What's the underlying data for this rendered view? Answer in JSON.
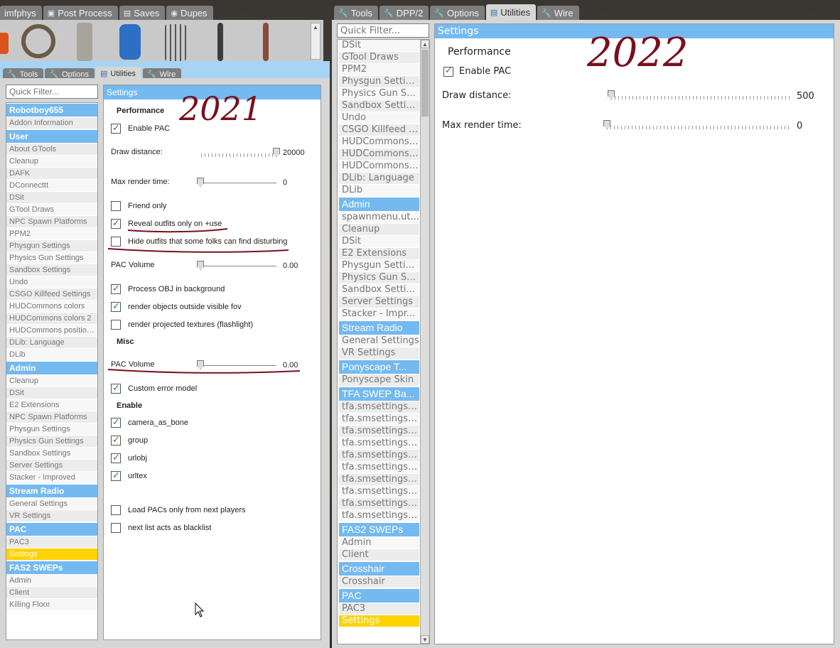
{
  "left_top_tabs": [
    {
      "label": "imfphys",
      "icon": "none"
    },
    {
      "label": "Post Process",
      "icon": "image-icon"
    },
    {
      "label": "Saves",
      "icon": "saves-icon"
    },
    {
      "label": "Dupes",
      "icon": "dupes-icon"
    }
  ],
  "left_inner_tabs": [
    {
      "label": "Tools",
      "active": false
    },
    {
      "label": "Options",
      "active": false
    },
    {
      "label": "Utilities",
      "active": true
    },
    {
      "label": "Wire",
      "active": false
    }
  ],
  "left": {
    "filter_placeholder": "Quick Filter...",
    "list": [
      {
        "type": "cat",
        "label": "Robotboy655"
      },
      {
        "type": "item",
        "label": "Addon Information"
      },
      {
        "type": "cat",
        "label": "User"
      },
      {
        "type": "item",
        "label": "About GTools"
      },
      {
        "type": "item",
        "label": "Cleanup"
      },
      {
        "type": "item",
        "label": "DAFK"
      },
      {
        "type": "item",
        "label": "DConnecttt"
      },
      {
        "type": "item",
        "label": "DSit"
      },
      {
        "type": "item",
        "label": "GTool Draws"
      },
      {
        "type": "item",
        "label": "NPC Spawn Platforms"
      },
      {
        "type": "item",
        "label": "PPM2"
      },
      {
        "type": "item",
        "label": "Physgun Settings"
      },
      {
        "type": "item",
        "label": "Physics Gun Settings"
      },
      {
        "type": "item",
        "label": "Sandbox Settings"
      },
      {
        "type": "item",
        "label": "Undo"
      },
      {
        "type": "item",
        "label": "CSGO Killfeed Settings"
      },
      {
        "type": "item",
        "label": "HUDCommons colors"
      },
      {
        "type": "item",
        "label": "HUDCommons colors 2"
      },
      {
        "type": "item",
        "label": "HUDCommons position..."
      },
      {
        "type": "item",
        "label": "DLib: Language"
      },
      {
        "type": "item",
        "label": "DLib"
      },
      {
        "type": "cat",
        "label": "Admin"
      },
      {
        "type": "item",
        "label": "Cleanup"
      },
      {
        "type": "item",
        "label": "DSit"
      },
      {
        "type": "item",
        "label": "E2 Extensions"
      },
      {
        "type": "item",
        "label": "NPC Spawn Platforms"
      },
      {
        "type": "item",
        "label": "Physgun Settings"
      },
      {
        "type": "item",
        "label": "Physics Gun Settings"
      },
      {
        "type": "item",
        "label": "Sandbox Settings"
      },
      {
        "type": "item",
        "label": "Server Settings"
      },
      {
        "type": "item",
        "label": "Stacker - Improved"
      },
      {
        "type": "cat",
        "label": "Stream Radio"
      },
      {
        "type": "item",
        "label": "General Settings"
      },
      {
        "type": "item",
        "label": "VR Settings"
      },
      {
        "type": "cat",
        "label": "PAC"
      },
      {
        "type": "item",
        "label": "PAC3"
      },
      {
        "type": "item",
        "label": "Settings",
        "selected": true
      },
      {
        "type": "cat",
        "label": "FAS2 SWEPs"
      },
      {
        "type": "item",
        "label": "Admin"
      },
      {
        "type": "item",
        "label": "Client"
      },
      {
        "type": "item",
        "label": "Killing Floor"
      }
    ],
    "settings_title": "Settings",
    "section_performance": "Performance",
    "enable_pac": "Enable PAC",
    "draw_distance_label": "Draw distance:",
    "draw_distance_value": "20000",
    "draw_distance_level": 1.0,
    "max_render_label": "Max render time:",
    "max_render_value": "0",
    "friend_only": "Friend only",
    "reveal_outfits": "Reveal outfits only on +use",
    "hide_outfits": "Hide outfits that some folks can find disturbing",
    "pac_volume_label": "PAC Volume",
    "pac_volume_value": "0.00",
    "process_obj": "Process OBJ in background",
    "render_outside": "render objects outside visible fov",
    "render_projected": "render projected textures (flashlight)",
    "section_misc": "Misc",
    "misc_pac_volume_label": "PAC Volume",
    "misc_pac_volume_value": "0.00",
    "custom_error": "Custom error model",
    "section_enable": "Enable",
    "camera_as_bone": "camera_as_bone",
    "group": "group",
    "urlobj": "urlobj",
    "urltex": "urltex",
    "load_pacs": "Load PACs only from next players",
    "next_list": "next list acts as blacklist",
    "handwritten_year": "2021"
  },
  "right_tabs": [
    {
      "label": "Tools",
      "active": false
    },
    {
      "label": "DPP/2",
      "active": false
    },
    {
      "label": "Options",
      "active": false
    },
    {
      "label": "Utilities",
      "active": true
    },
    {
      "label": "Wire",
      "active": false
    }
  ],
  "right": {
    "filter_placeholder": "Quick Filter...",
    "list": [
      {
        "type": "item",
        "label": "DSit"
      },
      {
        "type": "item",
        "label": "GTool Draws"
      },
      {
        "type": "item",
        "label": "PPM2"
      },
      {
        "type": "item",
        "label": "Physgun Settin..."
      },
      {
        "type": "item",
        "label": "Physics Gun Se..."
      },
      {
        "type": "item",
        "label": "Sandbox Settin..."
      },
      {
        "type": "item",
        "label": "Undo"
      },
      {
        "type": "item",
        "label": "CSGO Killfeed S..."
      },
      {
        "type": "item",
        "label": "HUDCommons ..."
      },
      {
        "type": "item",
        "label": "HUDCommons ..."
      },
      {
        "type": "item",
        "label": "HUDCommons ..."
      },
      {
        "type": "item",
        "label": "DLib: Language"
      },
      {
        "type": "item",
        "label": "DLib"
      },
      {
        "type": "cat",
        "label": "Admin"
      },
      {
        "type": "item",
        "label": "spawnmenu.ut..."
      },
      {
        "type": "item",
        "label": "Cleanup"
      },
      {
        "type": "item",
        "label": "DSit"
      },
      {
        "type": "item",
        "label": "E2 Extensions"
      },
      {
        "type": "item",
        "label": "Physgun Settin..."
      },
      {
        "type": "item",
        "label": "Physics Gun Se..."
      },
      {
        "type": "item",
        "label": "Sandbox Settin..."
      },
      {
        "type": "item",
        "label": "Server Settings"
      },
      {
        "type": "item",
        "label": "Stacker - Impr..."
      },
      {
        "type": "cat",
        "label": "Stream Radio"
      },
      {
        "type": "item",
        "label": "General Settings"
      },
      {
        "type": "item",
        "label": "VR Settings"
      },
      {
        "type": "cat",
        "label": "Ponyscape T..."
      },
      {
        "type": "item",
        "label": "Ponyscape Skin"
      },
      {
        "type": "cat",
        "label": "TFA SWEP Ba..."
      },
      {
        "type": "item",
        "label": "tfa.smsettings...."
      },
      {
        "type": "item",
        "label": "tfa.smsettings...."
      },
      {
        "type": "item",
        "label": "tfa.smsettings...."
      },
      {
        "type": "item",
        "label": "tfa.smsettings...."
      },
      {
        "type": "item",
        "label": "tfa.smsettings.i..."
      },
      {
        "type": "item",
        "label": "tfa.smsettings...."
      },
      {
        "type": "item",
        "label": "tfa.smsettings...."
      },
      {
        "type": "item",
        "label": "tfa.smsettings...."
      },
      {
        "type": "item",
        "label": "tfa.smsettings...."
      },
      {
        "type": "item",
        "label": "tfa.smsettings...."
      },
      {
        "type": "cat",
        "label": "FAS2 SWEPs"
      },
      {
        "type": "item",
        "label": "Admin"
      },
      {
        "type": "item",
        "label": "Client"
      },
      {
        "type": "cat",
        "label": "Crosshair"
      },
      {
        "type": "item",
        "label": "Crosshair"
      },
      {
        "type": "cat",
        "label": "PAC"
      },
      {
        "type": "item",
        "label": "PAC3"
      },
      {
        "type": "item",
        "label": "Settings",
        "selected": true
      }
    ],
    "settings_title": "Settings",
    "section_performance": "Performance",
    "enable_pac": "Enable PAC",
    "draw_distance_label": "Draw distance:",
    "draw_distance_value": "500",
    "draw_distance_level": 0.0,
    "max_render_label": "Max render time:",
    "max_render_value": "0",
    "handwritten_year": "2022"
  },
  "colors": {
    "accent": "#74b9ef",
    "selected": "#ffd200",
    "annotation": "#7a0f1e",
    "check": "#2a8a2a"
  }
}
